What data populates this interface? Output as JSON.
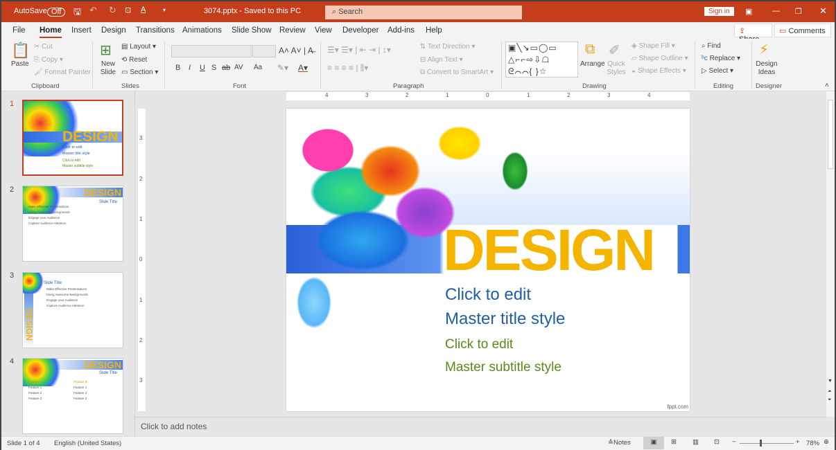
{
  "titlebar": {
    "autosave": "AutoSave",
    "autosave_state": "Off",
    "filename": "3074.pptx  -  Saved to this PC",
    "search_placeholder": "Search",
    "signin": "Sign in"
  },
  "tabs": [
    "File",
    "Home",
    "Insert",
    "Design",
    "Transitions",
    "Animations",
    "Slide Show",
    "Review",
    "View",
    "Developer",
    "Add-ins",
    "Help"
  ],
  "actions": {
    "share": "Share",
    "comments": "Comments"
  },
  "ribbon": {
    "clipboard": {
      "paste": "Paste",
      "cut": "Cut",
      "copy": "Copy",
      "format_painter": "Format Painter",
      "label": "Clipboard"
    },
    "slides": {
      "new_slide": "New Slide",
      "layout": "Layout",
      "reset": "Reset",
      "section": "Section",
      "label": "Slides"
    },
    "font": {
      "bold": "B",
      "italic": "I",
      "underline": "U",
      "strike": "S",
      "spacing": "AV",
      "case": "Aa",
      "label": "Font"
    },
    "paragraph": {
      "text_direction": "Text Direction",
      "align_text": "Align Text",
      "smartart": "Convert to SmartArt",
      "label": "Paragraph"
    },
    "drawing": {
      "arrange": "Arrange",
      "quick_styles": "Quick Styles",
      "shape_fill": "Shape Fill",
      "shape_outline": "Shape Outline",
      "shape_effects": "Shape Effects",
      "label": "Drawing"
    },
    "editing": {
      "find": "Find",
      "replace": "Replace",
      "select": "Select",
      "label": "Editing"
    },
    "designer": {
      "design_ideas": "Design Ideas",
      "label": "Designer"
    }
  },
  "thumbnails": [
    {
      "num": "1",
      "design": "DESIGN",
      "lines": [
        "Click to edit",
        "Master title style",
        "Click to edit",
        "Master subtitle style"
      ]
    },
    {
      "num": "2",
      "design": "DESIGN",
      "title": "Slide Title",
      "bullets": [
        "Make Effective Presentations",
        "Using Awesome Backgrounds",
        "Engage your Audience",
        "Capture Audience Attention"
      ]
    },
    {
      "num": "3",
      "design": "DESIGN",
      "title": "Slide Title",
      "bullets": [
        "Make Effective Presentations",
        "Using Awesome Backgrounds",
        "Engage your Audience",
        "Capture Audience Attention"
      ]
    },
    {
      "num": "4",
      "design": "DESIGN",
      "title": "Slide Title",
      "colA": "Product A",
      "colB": "Product B",
      "features": [
        "Feature 1",
        "Feature 2",
        "Feature 3"
      ]
    }
  ],
  "slide": {
    "design": "DESIGN",
    "title1": "Click to edit",
    "title2": "Master title style",
    "sub1": "Click to edit",
    "sub2": "Master subtitle style",
    "watermark": "fppt.com",
    "colors": {
      "title": "#1f5fa8",
      "subtitle": "#5a8a1a",
      "design": "#f5b400"
    }
  },
  "rulers": {
    "h": [
      "4",
      "3",
      "2",
      "1",
      "0",
      "1",
      "2",
      "3",
      "4"
    ],
    "v": [
      "3",
      "2",
      "1",
      "0",
      "1",
      "2",
      "3"
    ]
  },
  "notes": {
    "placeholder": "Click to add notes"
  },
  "status": {
    "slide": "Slide 1 of 4",
    "language": "English (United States)",
    "notes": "Notes",
    "zoom": "78%",
    "zoom_level": 78
  }
}
